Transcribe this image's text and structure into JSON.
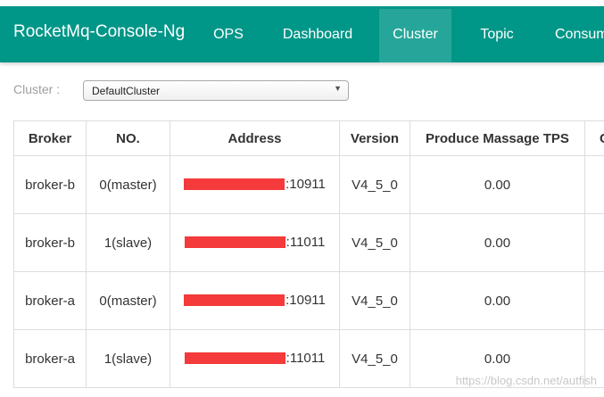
{
  "app": {
    "brand": "RocketMq-Console-Ng"
  },
  "nav": {
    "items": [
      {
        "label": "OPS"
      },
      {
        "label": "Dashboard"
      },
      {
        "label": "Cluster"
      },
      {
        "label": "Topic"
      },
      {
        "label": "Consum"
      }
    ],
    "active": "Cluster"
  },
  "filter": {
    "label": "Cluster :",
    "selected": "DefaultCluster"
  },
  "table": {
    "headers": [
      "Broker",
      "NO.",
      "Address",
      "Version",
      "Produce Massage TPS",
      "C"
    ],
    "rows": [
      {
        "broker": "broker-b",
        "no": "0(master)",
        "port": ":10911",
        "version": "V4_5_0",
        "tps": "0.00"
      },
      {
        "broker": "broker-b",
        "no": "1(slave)",
        "port": ":11011",
        "version": "V4_5_0",
        "tps": "0.00"
      },
      {
        "broker": "broker-a",
        "no": "0(master)",
        "port": ":10911",
        "version": "V4_5_0",
        "tps": "0.00"
      },
      {
        "broker": "broker-a",
        "no": "1(slave)",
        "port": ":11011",
        "version": "V4_5_0",
        "tps": "0.00"
      }
    ]
  },
  "watermark": "https://blog.csdn.net/autfish",
  "colors": {
    "navbar": "#009688",
    "nav_active": "#26a69a",
    "redaction": "#f43a3a"
  }
}
